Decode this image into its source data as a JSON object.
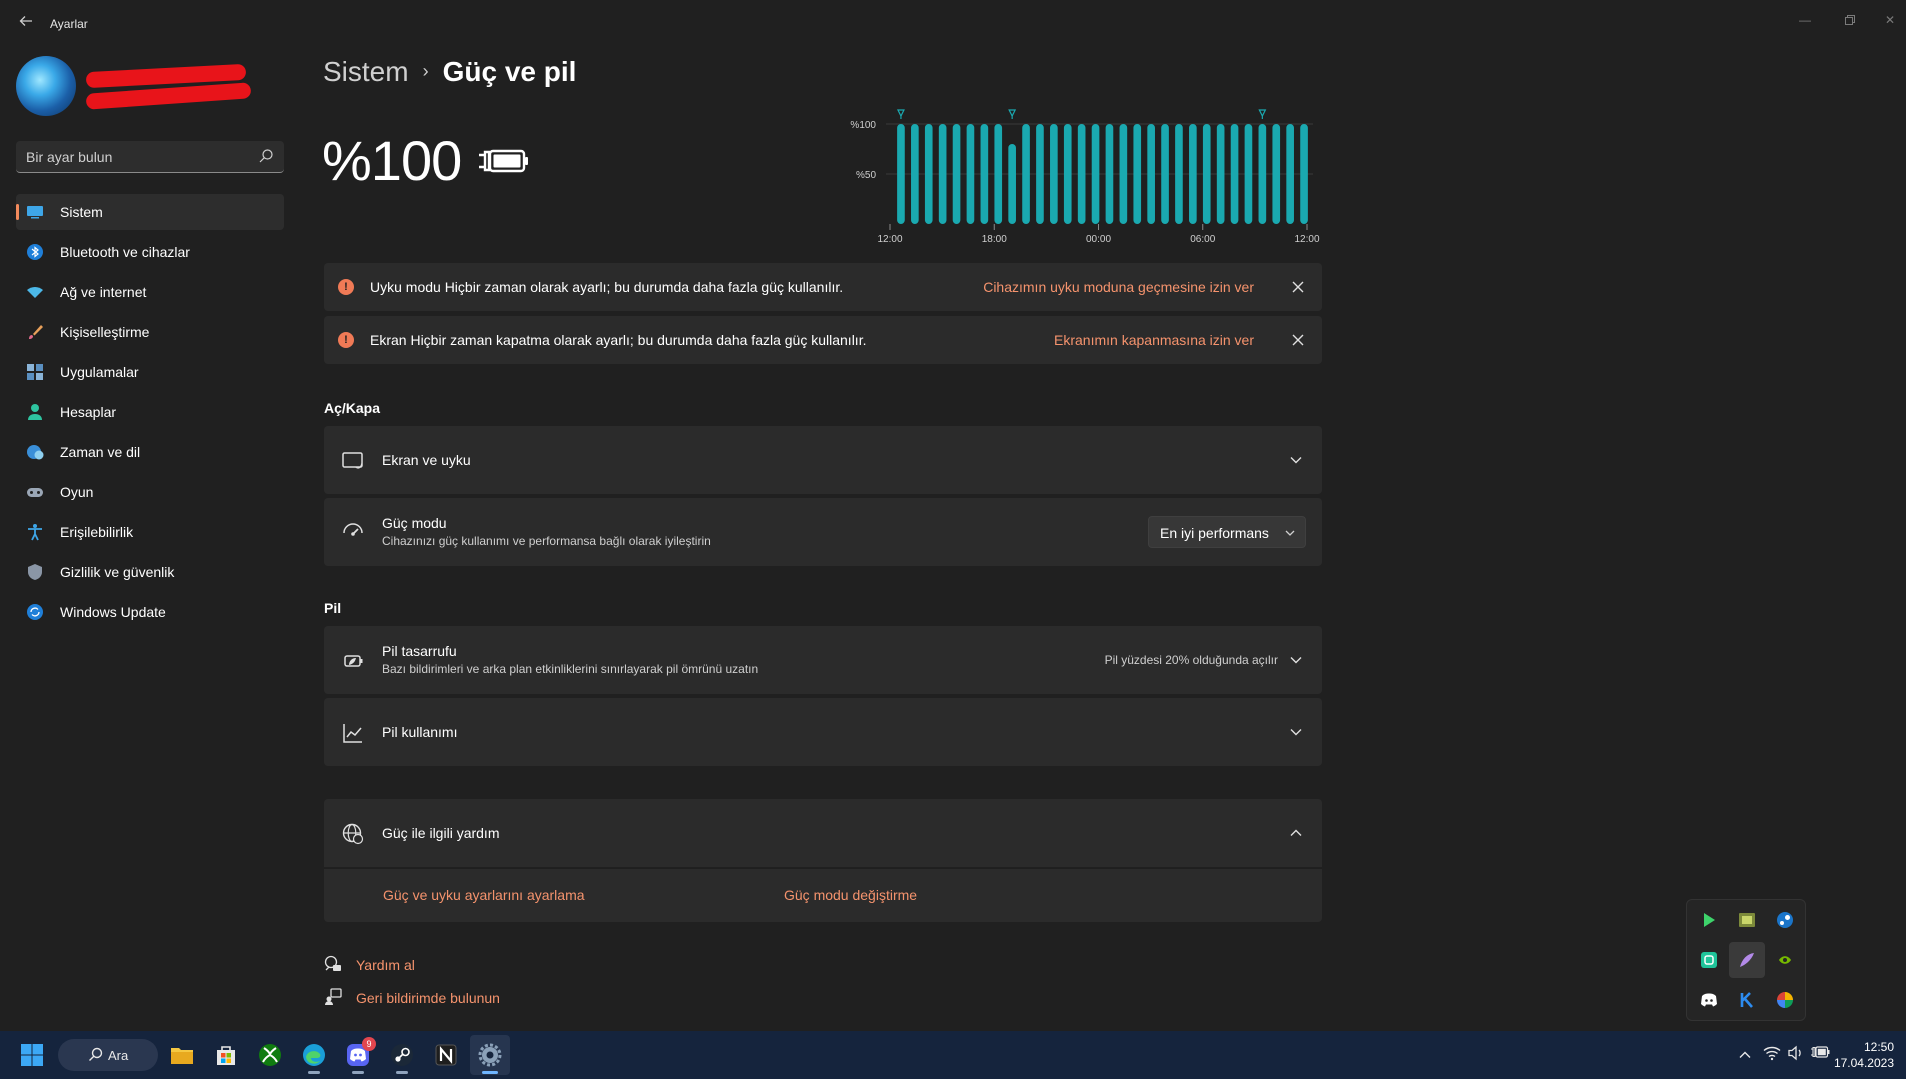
{
  "window": {
    "title": "Ayarlar"
  },
  "sidebar": {
    "search_placeholder": "Bir ayar bulun",
    "items": [
      {
        "label": "Sistem",
        "icon": "monitor-icon",
        "active": true
      },
      {
        "label": "Bluetooth ve cihazlar",
        "icon": "bluetooth-icon"
      },
      {
        "label": "Ağ ve internet",
        "icon": "wifi-icon"
      },
      {
        "label": "Kişiselleştirme",
        "icon": "paintbrush-icon"
      },
      {
        "label": "Uygulamalar",
        "icon": "apps-icon"
      },
      {
        "label": "Hesaplar",
        "icon": "person-icon"
      },
      {
        "label": "Zaman ve dil",
        "icon": "globe-clock-icon"
      },
      {
        "label": "Oyun",
        "icon": "gamepad-icon"
      },
      {
        "label": "Erişilebilirlik",
        "icon": "accessibility-icon"
      },
      {
        "label": "Gizlilik ve güvenlik",
        "icon": "shield-icon"
      },
      {
        "label": "Windows Update",
        "icon": "update-icon"
      }
    ]
  },
  "breadcrumb": {
    "parent": "Sistem",
    "separator": "›",
    "current": "Güç ve pil"
  },
  "battery": {
    "percent_label": "%100",
    "level": 1.0,
    "charging": true
  },
  "chart_data": {
    "type": "bar",
    "y_tick_labels": [
      "%100",
      "%50"
    ],
    "x_tick_labels": [
      "12:00",
      "18:00",
      "00:00",
      "06:00",
      "12:00"
    ],
    "ylim": [
      0,
      100
    ],
    "values": [
      100,
      100,
      100,
      100,
      100,
      100,
      100,
      100,
      80,
      100,
      100,
      100,
      100,
      100,
      100,
      100,
      100,
      100,
      100,
      100,
      100,
      100,
      100,
      100,
      100,
      100,
      100,
      100,
      100,
      100
    ],
    "plug_markers": [
      0,
      8,
      26
    ],
    "bar_color": "#1aa9b0"
  },
  "warnings": [
    {
      "text": "Uyku modu Hiçbir zaman olarak ayarlı; bu durumda daha fazla güç kullanılır.",
      "link": "Cihazımın uyku moduna geçmesine izin ver"
    },
    {
      "text": "Ekran Hiçbir zaman kapatma olarak ayarlı; bu durumda daha fazla güç kullanılır.",
      "link": "Ekranımın kapanmasına izin ver"
    }
  ],
  "sections": {
    "power": "Aç/Kapa",
    "battery": "Pil"
  },
  "rows": {
    "screen_sleep": {
      "title": "Ekran ve uyku"
    },
    "power_mode": {
      "title": "Güç modu",
      "subtitle": "Cihazınızı güç kullanımı ve performansa bağlı olarak iyileştirin",
      "value": "En iyi performans"
    },
    "battery_saver": {
      "title": "Pil tasarrufu",
      "subtitle": "Bazı bildirimleri ve arka plan etkinliklerini sınırlayarak pil ömrünü uzatın",
      "status": "Pil yüzdesi 20% olduğunda açılır"
    },
    "battery_usage": {
      "title": "Pil kullanımı"
    },
    "help": {
      "title": "Güç ile ilgili yardım",
      "links": [
        "Güç ve uyku ayarlarını ayarlama",
        "Güç modu değiştirme"
      ]
    }
  },
  "footer": {
    "get_help": "Yardım al",
    "feedback": "Geri bildirimde bulunun"
  },
  "taskbar": {
    "search_label": "Ara",
    "discord_badge": "9",
    "time": "12:50",
    "date": "17.04.2023"
  },
  "colors": {
    "accent": "#f38a5c",
    "link": "#f5936d",
    "warning": "#f07a56",
    "chart_bar": "#1aa9b0"
  }
}
